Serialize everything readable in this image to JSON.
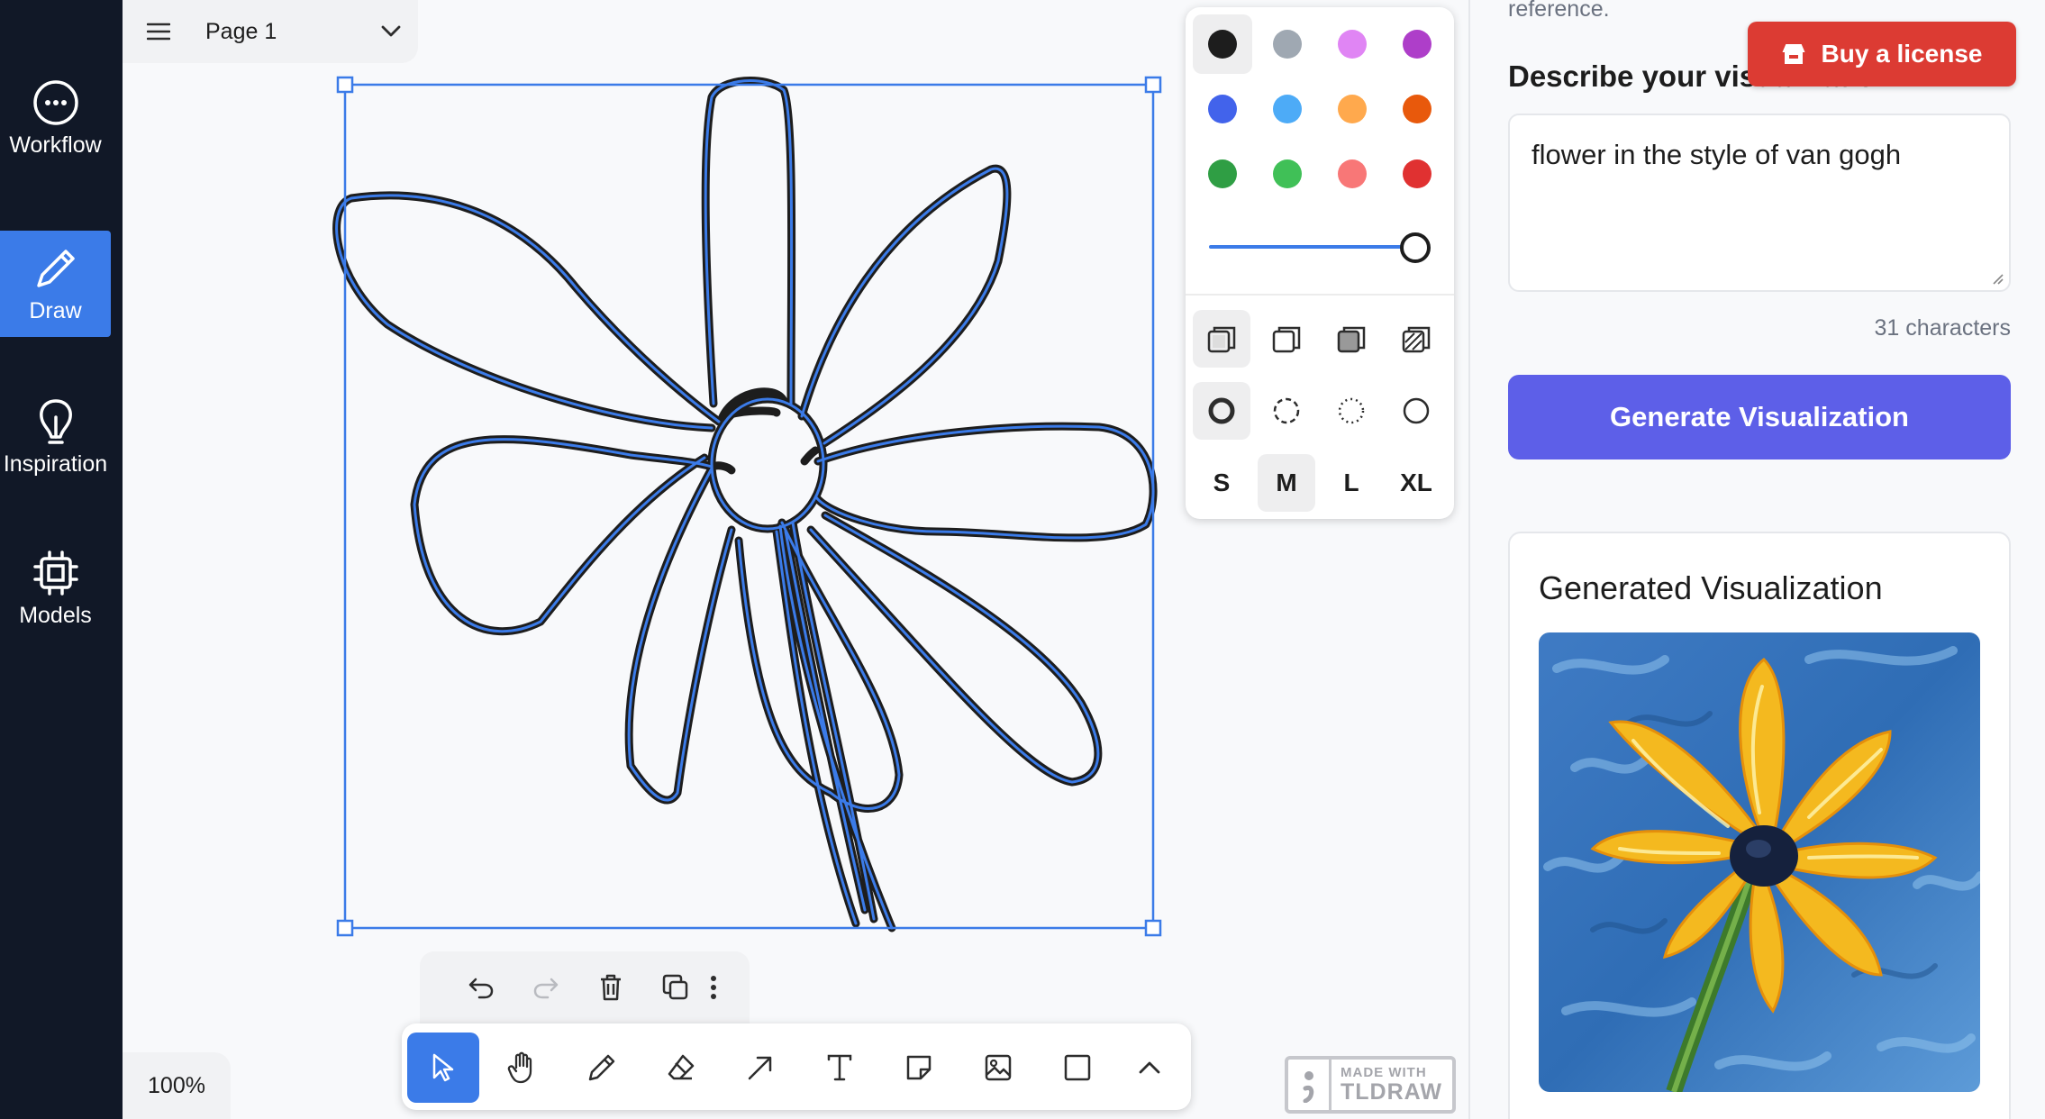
{
  "sidebar": {
    "items": [
      {
        "label": "Workflow",
        "icon": "ellipsis-circle-icon"
      },
      {
        "label": "Draw",
        "icon": "pencil-icon",
        "active": true
      },
      {
        "label": "Inspiration",
        "icon": "lightbulb-icon"
      },
      {
        "label": "Models",
        "icon": "chip-icon"
      }
    ]
  },
  "canvas": {
    "page_name": "Page 1",
    "zoom": "100%",
    "watermark": {
      "line1": "MADE WITH",
      "line2": "TLDRAW"
    }
  },
  "style_panel": {
    "colors": [
      "#1d1d1d",
      "#9fa8b2",
      "#e085f4",
      "#ae3ec9",
      "#4263eb",
      "#4dabf7",
      "#ffa94d",
      "#e8590c",
      "#2f9e44",
      "#40c057",
      "#f87777",
      "#e03131"
    ],
    "selected_color": "#1d1d1d",
    "opacity": 1.0,
    "fill_options": [
      "fill-none-icon",
      "fill-semi-icon",
      "fill-solid-icon",
      "fill-pattern-icon"
    ],
    "dash_options": [
      "dash-draw-icon",
      "dash-dashed-icon",
      "dash-dotted-icon",
      "dash-solid-icon"
    ],
    "sizes": [
      "S",
      "M",
      "L",
      "XL"
    ],
    "selected_size": "M"
  },
  "action_bar": [
    "undo-icon",
    "redo-icon",
    "trash-icon",
    "duplicate-icon",
    "more-icon"
  ],
  "toolbar": [
    "select-icon",
    "hand-icon",
    "pencil-icon",
    "eraser-icon",
    "arrow-icon",
    "text-icon",
    "note-icon",
    "image-icon",
    "rectangle-icon",
    "chevron-up-icon"
  ],
  "right_panel": {
    "reference_text": "reference.",
    "describe_label": "Describe your visualization",
    "buy_button": "Buy a license",
    "prompt": "flower in the style of van gogh",
    "char_count": "31 characters",
    "generate_button": "Generate Visualization",
    "result_title": "Generated Visualization"
  },
  "colors": {
    "sidebar_bg": "#111827",
    "accent_blue": "#3b7be8",
    "generate_btn": "#5d5fe8",
    "buy_btn": "#dc3b33"
  }
}
